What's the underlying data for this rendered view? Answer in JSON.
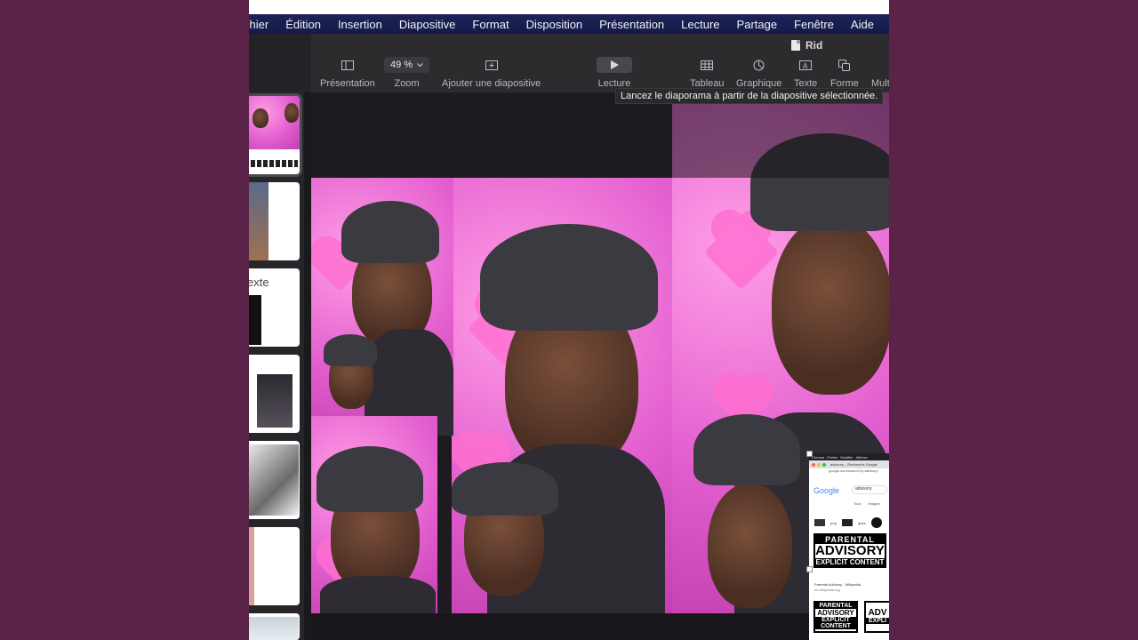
{
  "menu": [
    "Fichier",
    "Édition",
    "Insertion",
    "Diapositive",
    "Format",
    "Disposition",
    "Présentation",
    "Lecture",
    "Partage",
    "Fenêtre",
    "Aide"
  ],
  "menu_visible_first": "chier",
  "document": {
    "title": "Rid"
  },
  "toolbar": {
    "presentation_label": "Présentation",
    "zoom_value": "49 %",
    "zoom_label": "Zoom",
    "add_slide_label": "Ajouter une diapositive",
    "play_label": "Lecture",
    "table_label": "Tableau",
    "chart_label": "Graphique",
    "text_label": "Texte",
    "shape_label": "Forme",
    "media_label": "Mult"
  },
  "tooltip": "Lancez le diaporama à partir de la diapositive sélectionnée.",
  "sidebar": {
    "thumb3_text": "exte"
  },
  "embedded_screenshot": {
    "menu_items": [
      "Chrome",
      "Fichier",
      "Modifier",
      "Afficher"
    ],
    "tab_title": "advisory – Recherche Google",
    "url": "google.com/search?q=advisory",
    "google_logo": "Google",
    "query": "advisory",
    "chips": [
      "Tous",
      "Images"
    ],
    "related": [
      "png",
      "lyrics"
    ],
    "pa_line1": "PARENTAL",
    "pa_line2": "ADVISORY",
    "pa_line3": "EXPLICIT CONTENT",
    "result_caption": "Parental Advisory - Wikipedia",
    "result_domain": "en.wikipedia.org",
    "pa_small2_top": "ADV",
    "pa_small2_bottom": "EXPLI"
  },
  "colors": {
    "wallpaper": "#5a2347",
    "menubar": "#1e2358",
    "toolbar": "#2c2b2e",
    "pink": "#ff6fd0"
  }
}
